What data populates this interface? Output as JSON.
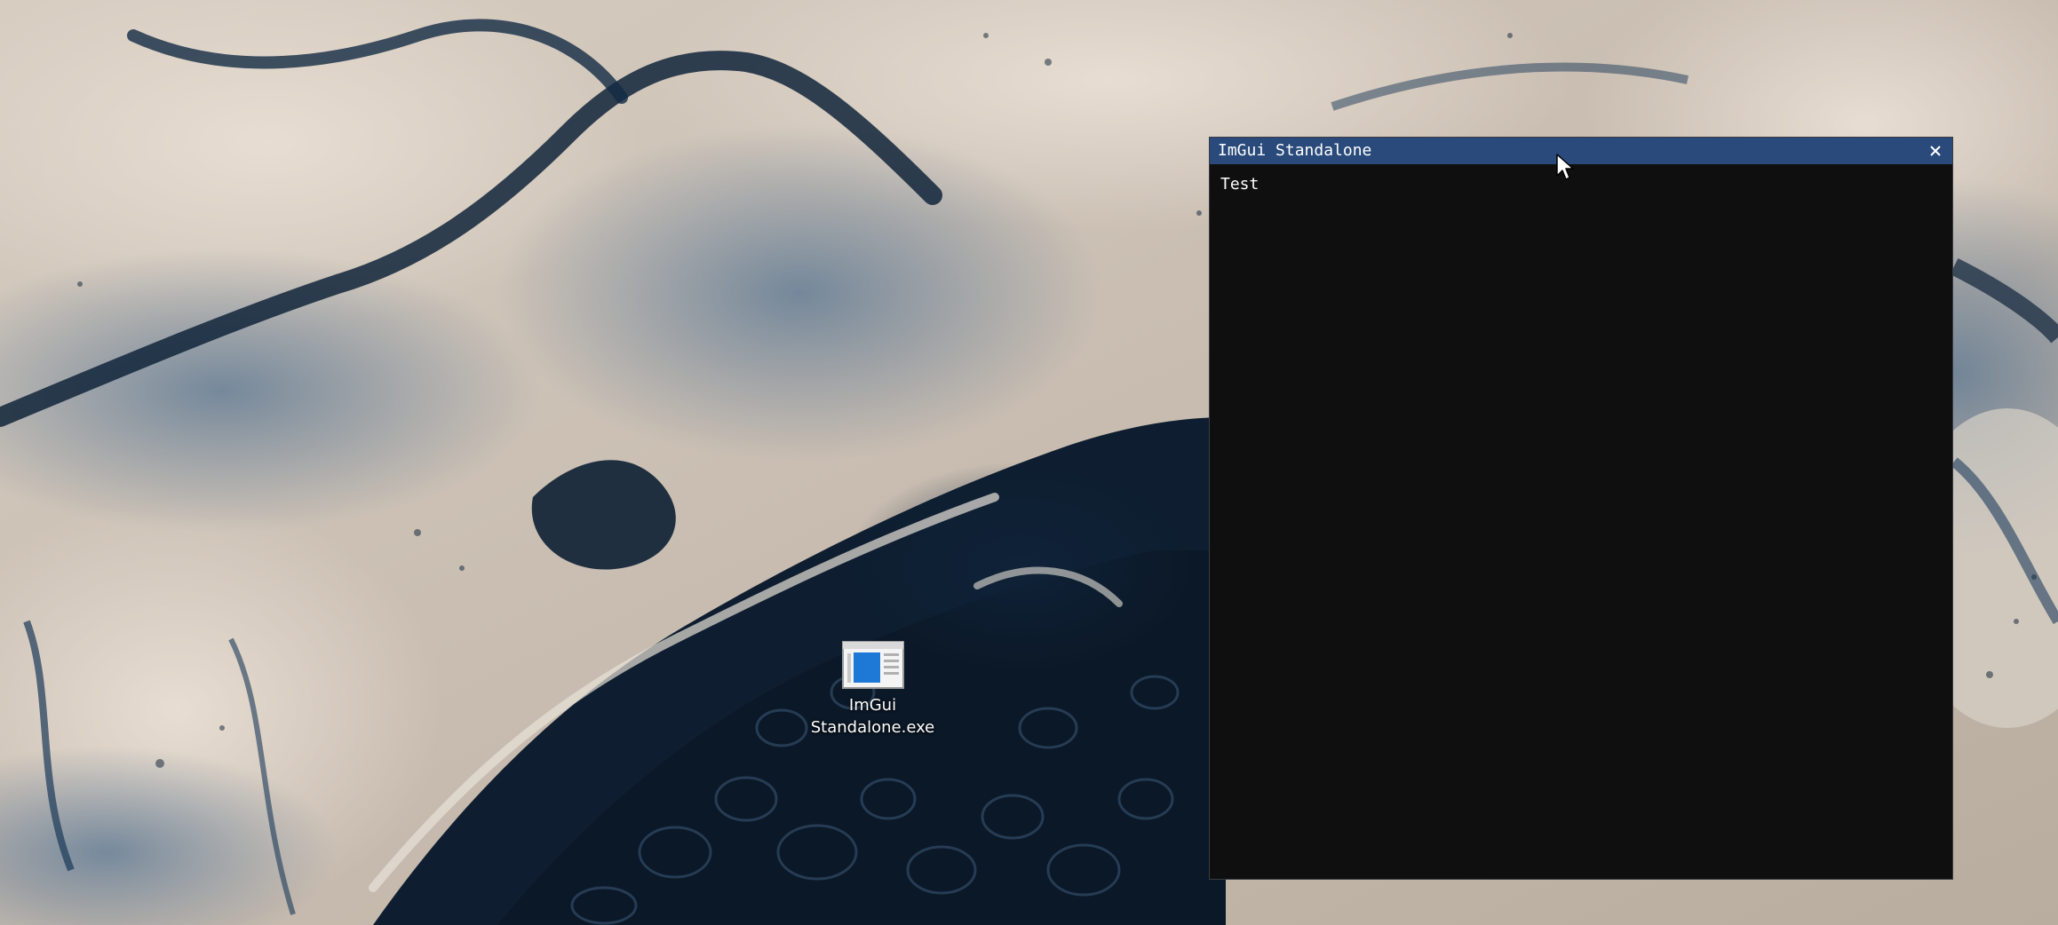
{
  "desktop": {
    "icons": [
      {
        "label_line1": "ImGui",
        "label_line2": "Standalone.exe",
        "icon": "application-window-icon",
        "accent_color": "#1e78d6"
      }
    ]
  },
  "window": {
    "title": "ImGui Standalone",
    "close_icon": "close-icon",
    "content_text": "Test",
    "titlebar_color": "#294a7a",
    "background_color": "#0f0f0f"
  },
  "cursor": {
    "icon": "arrow-cursor-icon"
  }
}
